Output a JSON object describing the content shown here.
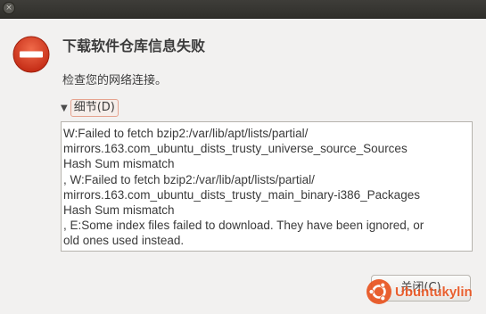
{
  "window": {
    "close_glyph": "×"
  },
  "dialog": {
    "icon": "error-icon",
    "title": "下载软件仓库信息失败",
    "subtitle": "检查您的网络连接。",
    "details_label": "细节(D)",
    "details_text": "W:Failed to fetch bzip2:/var/lib/apt/lists/partial/\nmirrors.163.com_ubuntu_dists_trusty_universe_source_Sources\nHash Sum mismatch\n, W:Failed to fetch bzip2:/var/lib/apt/lists/partial/\nmirrors.163.com_ubuntu_dists_trusty_main_binary-i386_Packages\nHash Sum mismatch\n, E:Some index files failed to download. They have been ignored, or\nold ones used instead.",
    "close_button_label": "关闭(C)"
  },
  "watermark": {
    "text": "Ubuntukylin"
  },
  "colors": {
    "error_red": "#d9381e",
    "accent": "#e95420"
  }
}
